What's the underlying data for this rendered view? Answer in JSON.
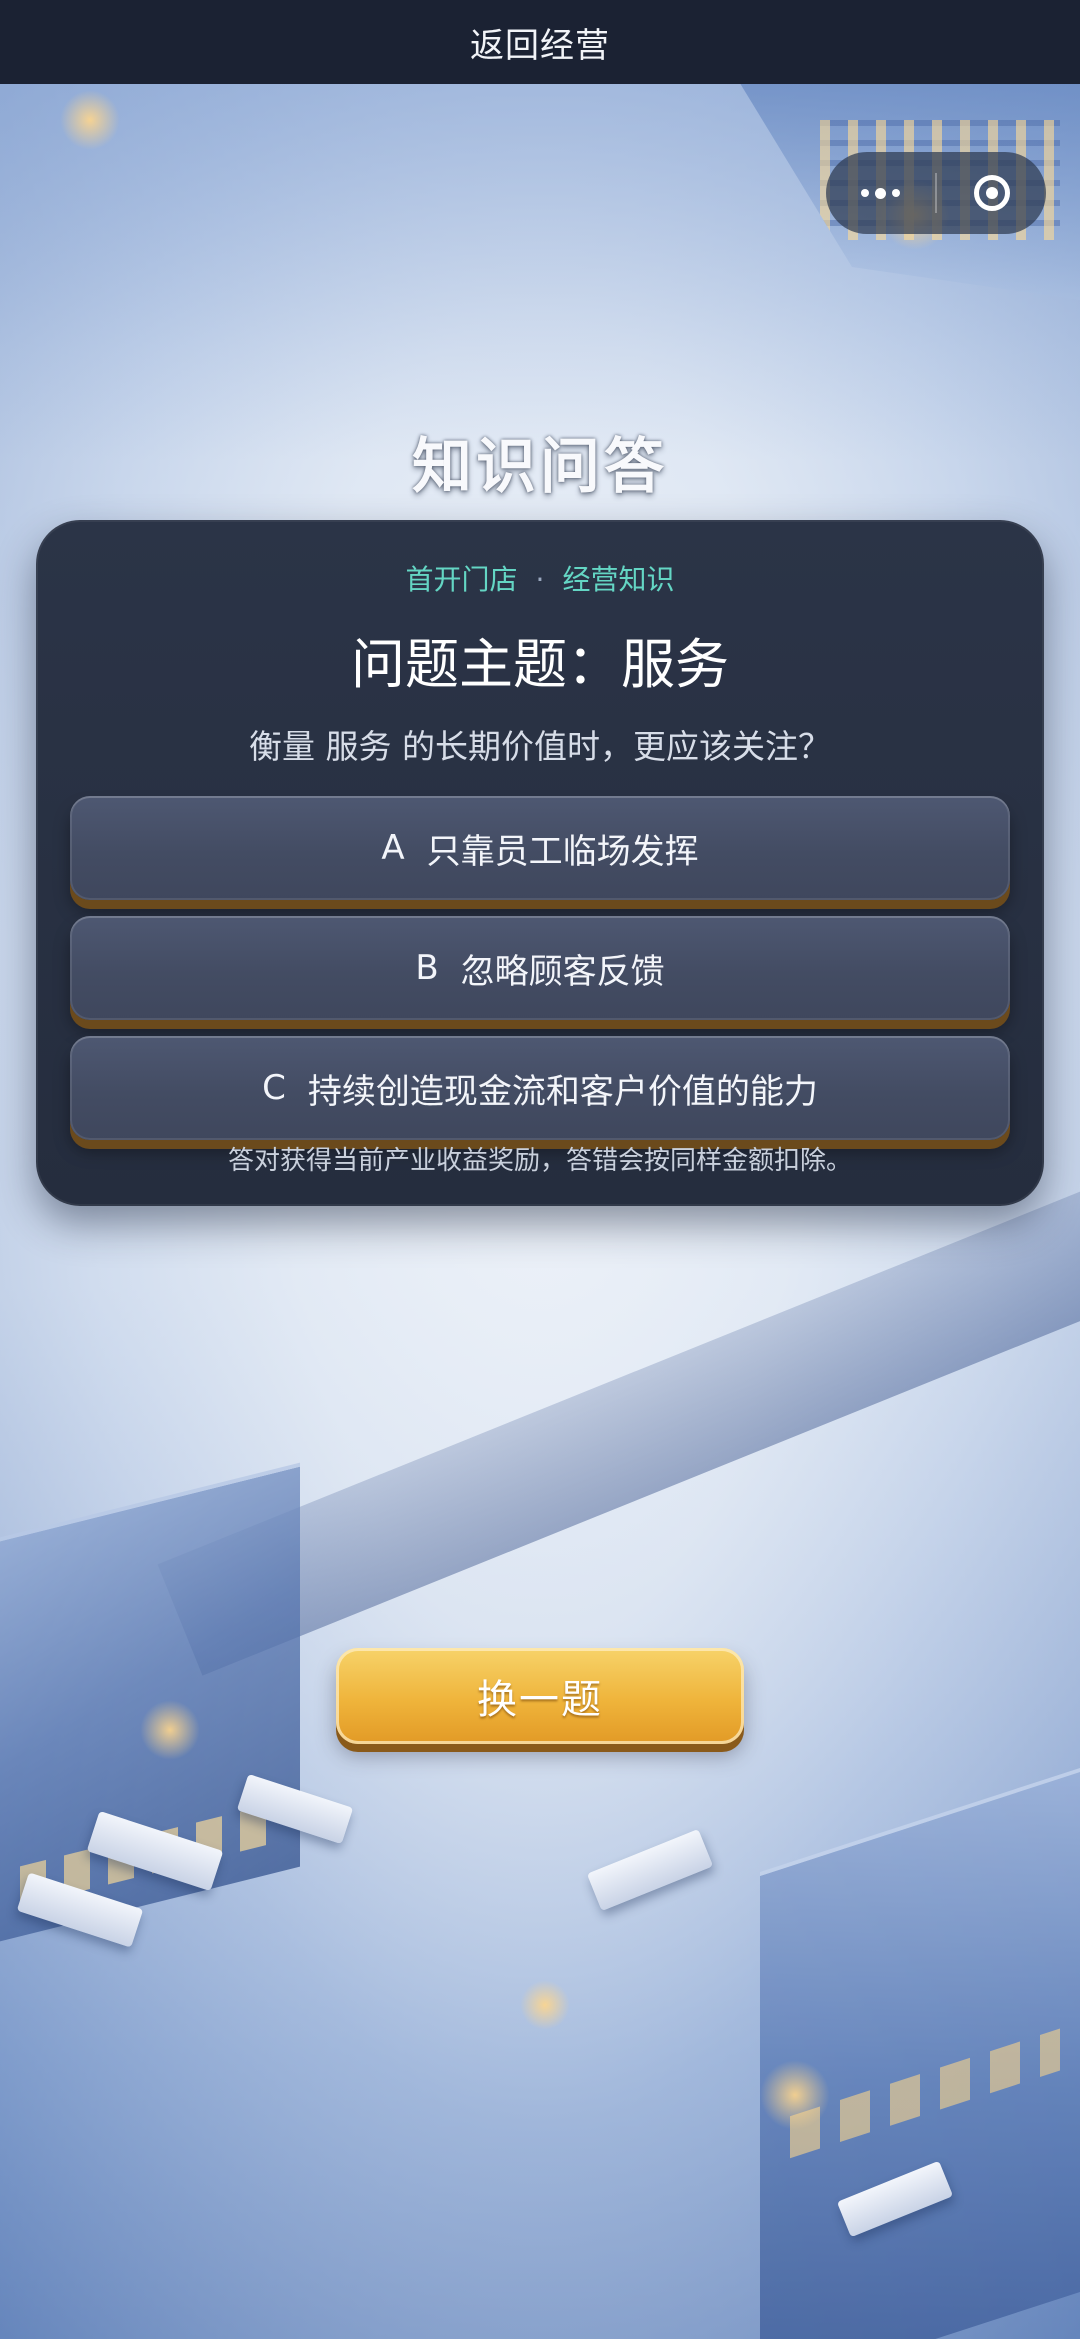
{
  "topbar": {
    "title": "返回经营"
  },
  "capsule": {
    "more_icon": "more-dots-icon",
    "close_icon": "target-circle-icon"
  },
  "page": {
    "title": "知识问答"
  },
  "quiz": {
    "crumb_store": "首开门店",
    "crumb_sep": "·",
    "crumb_category": "经营知识",
    "topic": "问题主题：服务",
    "question": "衡量 服务 的长期价值时，更应该关注？",
    "options": [
      {
        "letter": "A",
        "text": "只靠员工临场发挥"
      },
      {
        "letter": "B",
        "text": "忽略顾客反馈"
      },
      {
        "letter": "C",
        "text": "持续创造现金流和客户价值的能力"
      }
    ],
    "note": "答对获得当前产业收益奖励，答错会按同样金额扣除。"
  },
  "actions": {
    "switch_label": "换一题"
  },
  "colors": {
    "accent_teal": "#64d6c4",
    "button_gold": "#efb43b",
    "card_bg": "#2b3447"
  }
}
